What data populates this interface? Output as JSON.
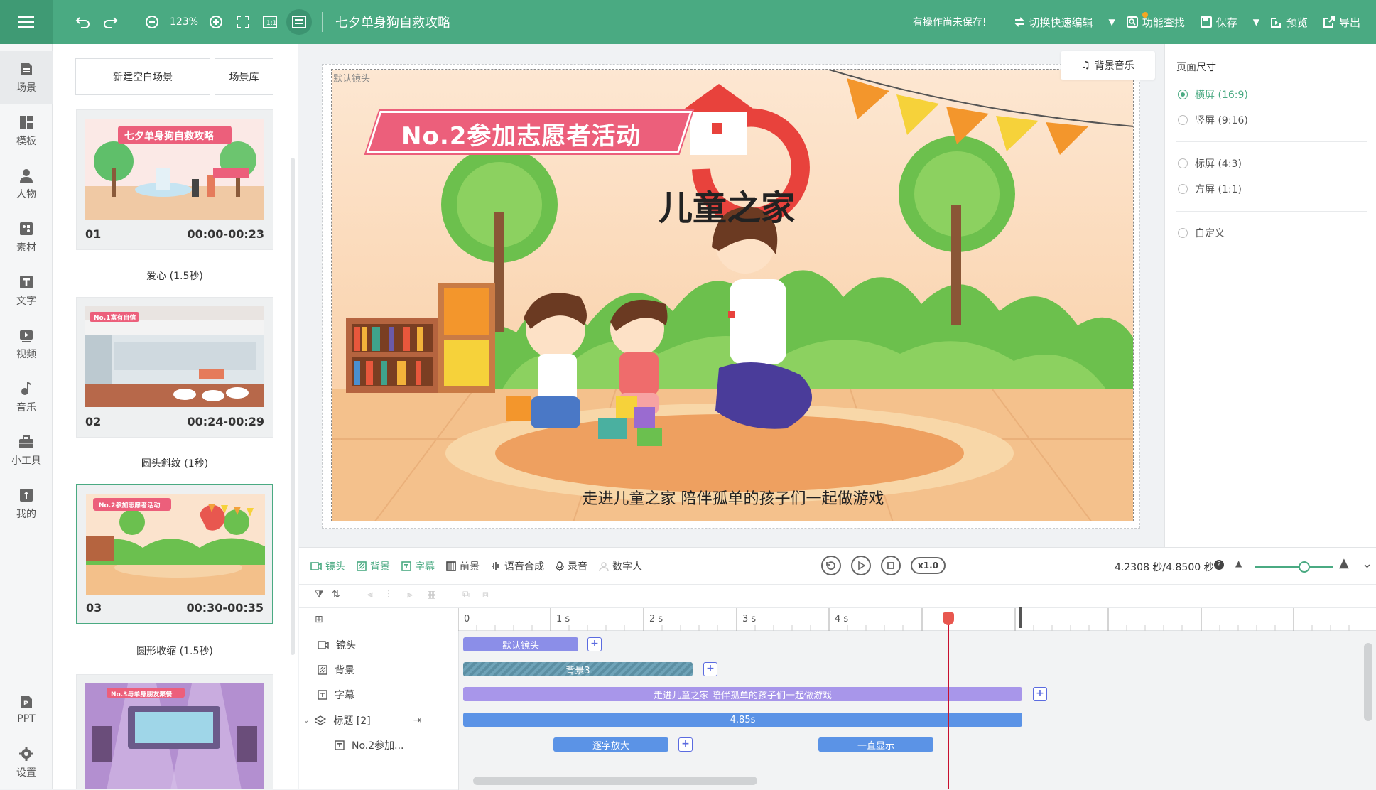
{
  "topbar": {
    "zoom": "123%",
    "doc_title": "七夕单身狗自救攻略",
    "unsaved": "有操作尚未保存!",
    "switch_edit": "切换快速编辑",
    "feature_search": "功能查找",
    "save": "保存",
    "preview": "预览",
    "export": "导出"
  },
  "rail": {
    "items": [
      {
        "label": "场景",
        "icon": "scene-icon"
      },
      {
        "label": "模板",
        "icon": "template-icon"
      },
      {
        "label": "人物",
        "icon": "person-icon"
      },
      {
        "label": "素材",
        "icon": "material-icon"
      },
      {
        "label": "文字",
        "icon": "text-icon"
      },
      {
        "label": "视频",
        "icon": "video-icon"
      },
      {
        "label": "音乐",
        "icon": "music-icon"
      },
      {
        "label": "小工具",
        "icon": "toolbox-icon"
      },
      {
        "label": "我的",
        "icon": "upload-icon"
      }
    ],
    "bottom": [
      {
        "label": "PPT",
        "icon": "ppt-icon"
      },
      {
        "label": "设置",
        "icon": "gear-icon"
      }
    ]
  },
  "scenes": {
    "new_blank": "新建空白场景",
    "library": "场景库",
    "cards": [
      {
        "num": "01",
        "time": "00:00-00:23",
        "transition": "爱心 (1.5秒)",
        "thumb_title": "七夕单身狗自救攻略"
      },
      {
        "num": "02",
        "time": "00:24-00:29",
        "transition": "圆头斜纹 (1秒)",
        "thumb_title": "No.1富有自信"
      },
      {
        "num": "03",
        "time": "00:30-00:35",
        "transition": "圆形收缩 (1.5秒)",
        "thumb_title": "No.2参加志愿者活动"
      },
      {
        "num": "",
        "time": "",
        "transition": "",
        "thumb_title": "No.3与单身朋友聚餐"
      }
    ]
  },
  "canvas": {
    "lens_label": "默认镜头",
    "bgm": "背景音乐",
    "banner": "No.2参加志愿者活动",
    "logo": "儿童之家",
    "subtitle": "走进儿童之家 陪伴孤单的孩子们一起做游戏"
  },
  "props": {
    "title": "页面尺寸",
    "options": [
      {
        "label": "横屏 (16:9)",
        "checked": true
      },
      {
        "label": "竖屏 (9:16)",
        "checked": false
      },
      {
        "label": "标屏 (4:3)",
        "checked": false
      },
      {
        "label": "方屏 (1:1)",
        "checked": false
      },
      {
        "label": "自定义",
        "checked": false
      }
    ]
  },
  "timeline": {
    "tabs": [
      "镜头",
      "背景",
      "字幕",
      "前景",
      "语音合成",
      "录音",
      "数字人"
    ],
    "speed": "x1.0",
    "time": "4.2308 秒/4.8500 秒",
    "zoom_level": 0.55,
    "ruler": [
      "0",
      "1 s",
      "2 s",
      "3 s",
      "4 s"
    ],
    "tracks": [
      "镜头",
      "背景",
      "字幕",
      "标题 [2]",
      "No.2参加..."
    ],
    "clips": {
      "lens": "默认镜头",
      "bg": "背景3",
      "sub": "走进儿童之家 陪伴孤单的孩子们一起做游戏",
      "title": "4.85s",
      "zoom_in": "逐字放大",
      "always": "一直显示"
    }
  },
  "colors": {
    "accent": "#4aaa82",
    "clip_lens": "#8b8ee8",
    "clip_sub": "#a896ea",
    "clip_title": "#5b93e6",
    "playhead": "#c8102e"
  }
}
